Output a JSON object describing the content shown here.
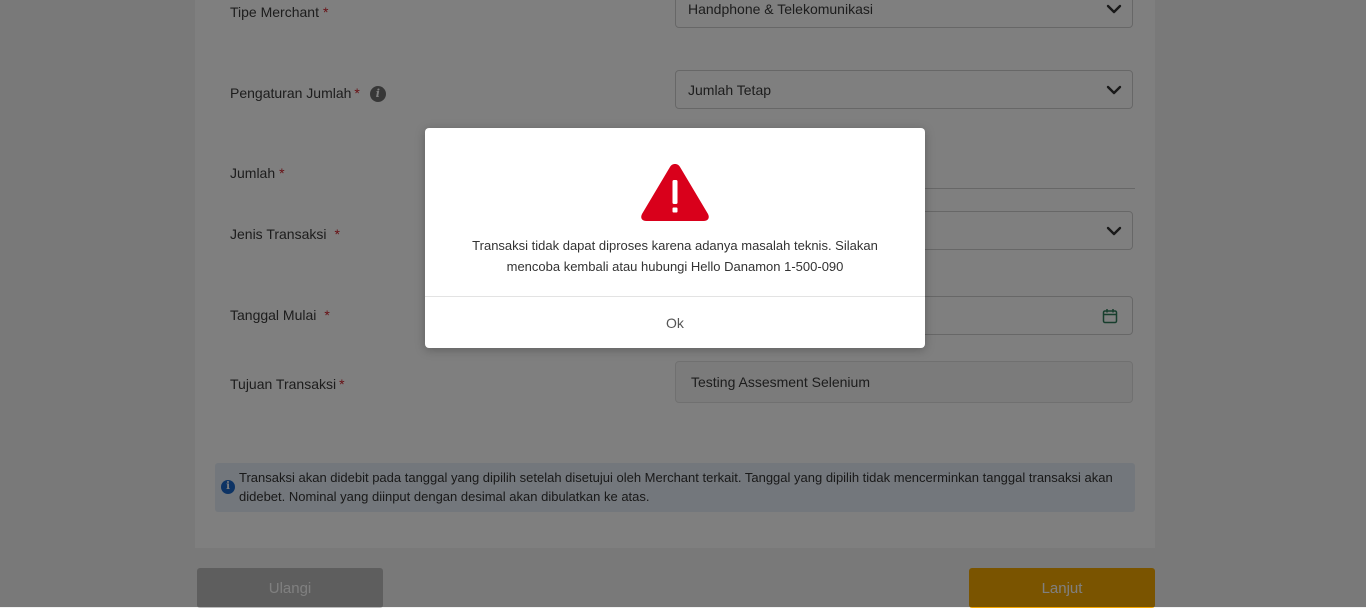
{
  "form": {
    "merchant_type": {
      "label": "Tipe Merchant",
      "required_mark": "*",
      "value": "Handphone & Telekomunikasi"
    },
    "amount_setting": {
      "label": "Pengaturan Jumlah",
      "required_mark": "*",
      "value": "Jumlah Tetap",
      "info_icon": "info-icon"
    },
    "amount": {
      "label": "Jumlah",
      "required_mark": "*"
    },
    "transaction_type": {
      "label": "Jenis Transaksi",
      "required_mark": "*"
    },
    "start_date": {
      "label": "Tanggal Mulai",
      "required_mark": "*",
      "icon": "calendar-icon"
    },
    "purpose": {
      "label": "Tujuan Transaksi",
      "required_mark": "*",
      "value": "Testing Assesment Selenium"
    }
  },
  "note": {
    "icon": "info-icon",
    "text": "Transaksi akan didebit pada tanggal yang dipilih setelah disetujui oleh Merchant terkait. Tanggal yang dipilih tidak mencerminkan tanggal transaksi akan didebet. Nominal yang diinput dengan desimal akan dibulatkan ke atas."
  },
  "buttons": {
    "reset": "Ulangi",
    "next": "Lanjut"
  },
  "modal": {
    "icon": "warning-icon",
    "message": "Transaksi tidak dapat diproses karena adanya masalah teknis. Silakan mencoba kembali atau hubungi Hello Danamon 1-500-090",
    "ok_label": "Ok"
  },
  "colors": {
    "required": "#d0202a",
    "warning": "#d9001b",
    "primary_button": "#f5a800",
    "disabled_button": "#bdbdbd",
    "note_background": "#e6eef8"
  }
}
